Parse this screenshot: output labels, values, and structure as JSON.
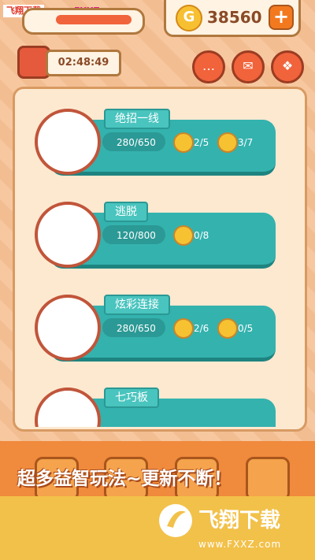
{
  "watermark": {
    "site_name": "飞翔下载",
    "url": "www.FXXZ.com"
  },
  "header": {
    "coins": "38560",
    "timer": "02:48:49"
  },
  "modes": [
    {
      "title": "绝招一线",
      "progress": "280/650",
      "medal1": "2/5",
      "medal2": "3/7"
    },
    {
      "title": "逃脱",
      "progress": "120/800",
      "medal1": "0/8",
      "medal2": ""
    },
    {
      "title": "炫彩连接",
      "progress": "280/650",
      "medal1": "2/6",
      "medal2": "0/5"
    },
    {
      "title": "七巧板",
      "progress": "",
      "medal1": "",
      "medal2": ""
    }
  ],
  "banner": {
    "text": "超多益智玩法~更新不断！"
  },
  "footer_logo": {
    "title": "飞翔下载",
    "url": "www.FXXZ.com"
  },
  "colors": {
    "teal": "#34b2ae",
    "orange": "#f1633b",
    "gold": "#f7c032"
  }
}
